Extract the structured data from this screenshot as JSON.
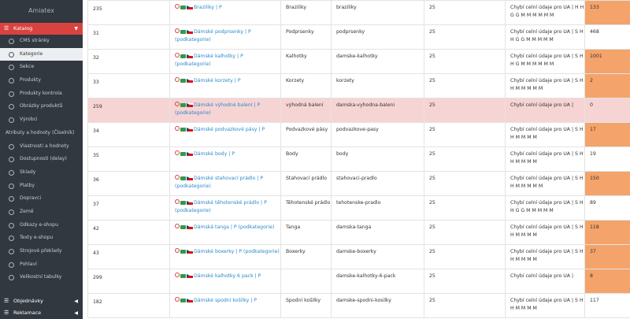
{
  "sidebar": {
    "brand": "Amiatex",
    "active_section": "Katalog",
    "items": [
      {
        "label": "CMS stránky"
      },
      {
        "label": "Kategorie"
      },
      {
        "label": "Sekce"
      },
      {
        "label": "Produkty"
      },
      {
        "label": "Produkty kontrola"
      },
      {
        "label": "Obrázky produktů"
      },
      {
        "label": "Výrobci"
      },
      {
        "label": "Atributy a hodnoty (Číselník)"
      },
      {
        "label": "Vlastnosti a hodnoty"
      },
      {
        "label": "Dostupnosti (delay)"
      },
      {
        "label": "Sklady"
      },
      {
        "label": "Platby"
      },
      {
        "label": "Dopravci"
      },
      {
        "label": "Země"
      },
      {
        "label": "Odkazy e-shopu"
      },
      {
        "label": "Texty e-shopu"
      },
      {
        "label": "Strojové překlady"
      },
      {
        "label": "Pohlaví"
      },
      {
        "label": "Velikostní tabulky"
      }
    ],
    "bottom": [
      {
        "label": "Objednávky"
      },
      {
        "label": "Reklamace"
      }
    ]
  },
  "colors": {
    "sidebar_bg": "#323840",
    "active_red": "#d9433f",
    "highlight_row": "#f7d4d4",
    "stock_orange": "#f4a46a",
    "link_blue": "#2c8ac9"
  },
  "icons": [
    "pin-icon",
    "camera-icon",
    "cz-flag-icon",
    "list-icon",
    "chevron-right-icon",
    "chevron-down-icon"
  ],
  "table": {
    "rows": [
      {
        "id": "235",
        "title": "Braziliky | P",
        "name": "Braziliky",
        "url": "braziliky",
        "n": "25",
        "note": "Chybí celní údaje pro UA | H H G G M M M M M M",
        "stock": "133",
        "stock_hl": true,
        "highlight": false
      },
      {
        "id": "31",
        "title": "Dámské podprsenky | P (podkategorie)",
        "name": "Podprsenky",
        "url": "podprsenky",
        "n": "25",
        "note": "Chybí celní údaje pro UA | S H H G G M M M M M",
        "stock": "468",
        "stock_hl": false,
        "highlight": false
      },
      {
        "id": "32",
        "title": "Dámské kalhotky | P (podkategorie)",
        "name": "Kalhotky",
        "url": "damske-kalhotky",
        "n": "25",
        "note": "Chybí celní údaje pro UA | S H H G M M M M M M",
        "stock": "1001",
        "stock_hl": true,
        "highlight": false
      },
      {
        "id": "33",
        "title": "Dámské korzety | P",
        "name": "Korzety",
        "url": "korzety",
        "n": "25",
        "note": "Chybí celní údaje pro UA | S H H M M M M M",
        "stock": "2",
        "stock_hl": true,
        "highlight": false
      },
      {
        "id": "259",
        "title": "Dámské výhodné balení | P (podkategorie)",
        "name": "výhodná balení",
        "url": "damska-vyhodna-baleni",
        "n": "25",
        "note": "Chybí celní údaje pro UA |",
        "stock": "0",
        "stock_hl": false,
        "highlight": true
      },
      {
        "id": "34",
        "title": "Dámské podvazkové pásy | P",
        "name": "Podvazkové pásy",
        "url": "podvazkove-pasy",
        "n": "25",
        "note": "Chybí celní údaje pro UA | S H H M M M M",
        "stock": "17",
        "stock_hl": true,
        "highlight": false
      },
      {
        "id": "35",
        "title": "Dámské body | P",
        "name": "Body",
        "url": "body",
        "n": "25",
        "note": "Chybí celní údaje pro UA | S H H M M M M",
        "stock": "19",
        "stock_hl": false,
        "highlight": false
      },
      {
        "id": "36",
        "title": "Dámské stahovací prádlo | P (podkategorie)",
        "name": "Stahovací prádlo",
        "url": "stahovaci-pradlo",
        "n": "25",
        "note": "Chybí celní údaje pro UA | S H H M M M M M",
        "stock": "150",
        "stock_hl": true,
        "highlight": false
      },
      {
        "id": "37",
        "title": "Dámské těhotenské prádlo | P (podkategorie)",
        "name": "Těhotenské prádlo",
        "url": "tehotenske-pradlo",
        "n": "25",
        "note": "Chybí celní údaje pro UA | S H H G G M M M M M",
        "stock": "89",
        "stock_hl": false,
        "highlight": false
      },
      {
        "id": "42",
        "title": "Dámská tanga | P (podkategorie)",
        "name": "Tanga",
        "url": "damska-tanga",
        "n": "25",
        "note": "Chybí celní údaje pro UA | S H H M M M M",
        "stock": "118",
        "stock_hl": true,
        "highlight": false
      },
      {
        "id": "43",
        "title": "Dámské boxerky | P (podkategorie)",
        "name": "Boxerky",
        "url": "damske-boxerky",
        "n": "25",
        "note": "Chybí celní údaje pro UA | S H H M M M M",
        "stock": "37",
        "stock_hl": true,
        "highlight": false
      },
      {
        "id": "299",
        "title": "Dámské kalhotky 6 pack | P",
        "name": "",
        "url": "damske-kalhotky-6-pack",
        "n": "25",
        "note": "Chybí celní údaje pro UA |",
        "stock": "8",
        "stock_hl": true,
        "highlight": false
      },
      {
        "id": "182",
        "title": "Dámské spodní košilky | P",
        "name": "Spodní košilky",
        "url": "damske-spodni-kosilky",
        "n": "25",
        "note": "Chybí celní údaje pro UA | S H H M M M M",
        "stock": "117",
        "stock_hl": false,
        "highlight": false
      }
    ]
  }
}
